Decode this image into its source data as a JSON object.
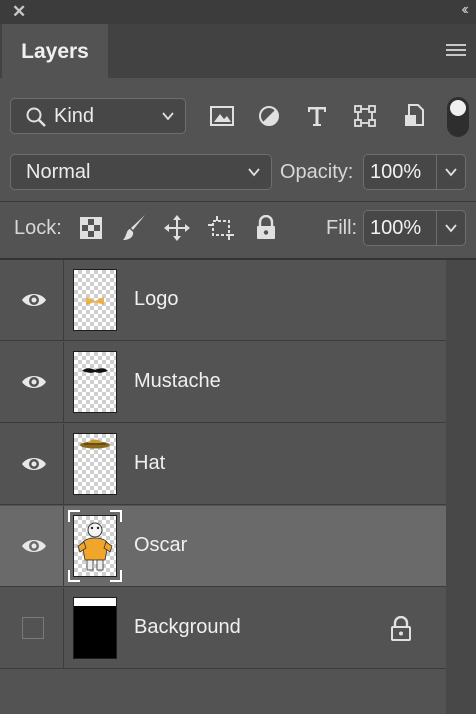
{
  "panel": {
    "tab_label": "Layers",
    "close_glyph": "✕",
    "collapse_glyph": "‹‹"
  },
  "filter": {
    "kind_label": "Kind",
    "filter_icons": [
      "image-filter-icon",
      "adjustment-filter-icon",
      "type-filter-icon",
      "shape-filter-icon",
      "smart-object-filter-icon"
    ]
  },
  "blend": {
    "mode": "Normal",
    "opacity_label": "Opacity:",
    "opacity_value": "100%"
  },
  "lock": {
    "label": "Lock:",
    "fill_label": "Fill:",
    "fill_value": "100%"
  },
  "layers": [
    {
      "name": "Logo",
      "visible": true,
      "selected": false,
      "locked": false,
      "thumb": "logo"
    },
    {
      "name": "Mustache",
      "visible": true,
      "selected": false,
      "locked": false,
      "thumb": "mustache"
    },
    {
      "name": "Hat",
      "visible": true,
      "selected": false,
      "locked": false,
      "thumb": "hat"
    },
    {
      "name": "Oscar",
      "visible": true,
      "selected": true,
      "locked": false,
      "thumb": "oscar"
    },
    {
      "name": "Background",
      "visible": false,
      "selected": false,
      "locked": true,
      "thumb": "background"
    }
  ],
  "colors": {
    "panel_bg": "#535353",
    "selected_row": "#6a6a6a",
    "hat_yellow": "#c99a33",
    "oscar_orange": "#f0a62a"
  }
}
